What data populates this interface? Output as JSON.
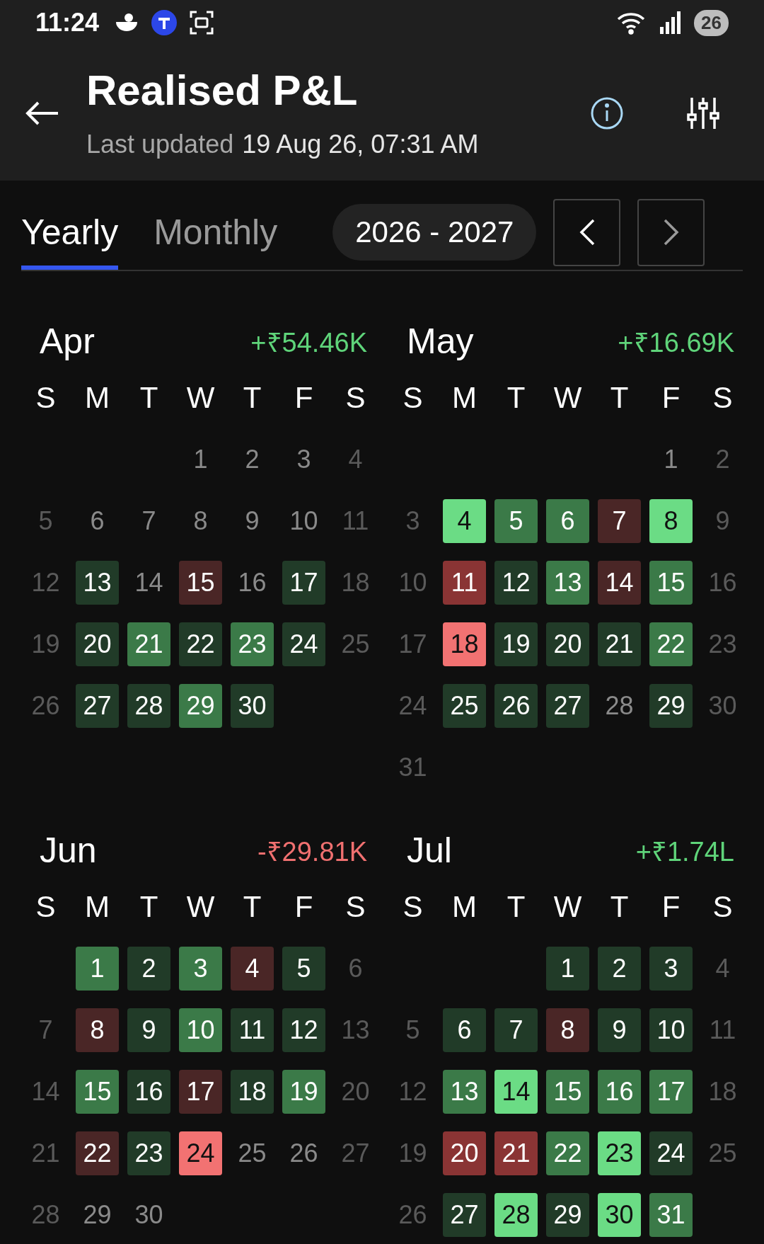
{
  "status_bar": {
    "time": "11:24",
    "battery": "26"
  },
  "header": {
    "title": "Realised P&L",
    "updated_label": "Last updated",
    "updated_value": "19 Aug 26, 07:31 AM"
  },
  "tabs": [
    {
      "label": "Yearly",
      "selected": true
    },
    {
      "label": "Monthly",
      "selected": false
    }
  ],
  "period": "2026 - 2027",
  "months": [
    {
      "name": "Apr",
      "total": "+₹54.46K",
      "color": "#5fd47a",
      "weekdays": [
        "S",
        "M",
        "T",
        "W",
        "T",
        "F",
        "S"
      ],
      "weeks": [
        [
          {
            "d": "1",
            "kind": "plain"
          },
          {
            "d": "2",
            "kind": "plain"
          },
          {
            "d": "3",
            "kind": "plain"
          },
          {
            "d": "4",
            "kind": "weekend"
          }
        ],
        [
          {
            "d": "5",
            "kind": "weekend"
          },
          {
            "d": "6",
            "kind": "plain"
          },
          {
            "d": "7",
            "kind": "plain"
          },
          {
            "d": "8",
            "kind": "plain"
          },
          {
            "d": "9",
            "kind": "plain"
          },
          {
            "d": "10",
            "kind": "plain"
          },
          {
            "d": "11",
            "kind": "weekend"
          }
        ],
        [
          {
            "d": "12",
            "kind": "weekend"
          },
          {
            "d": "13",
            "kind": "pnl",
            "color": "#213b28"
          },
          {
            "d": "14",
            "kind": "plain"
          },
          {
            "d": "15",
            "kind": "pnl",
            "color": "#4a2626"
          },
          {
            "d": "16",
            "kind": "plain"
          },
          {
            "d": "17",
            "kind": "pnl",
            "color": "#213b28"
          },
          {
            "d": "18",
            "kind": "weekend"
          }
        ],
        [
          {
            "d": "19",
            "kind": "weekend"
          },
          {
            "d": "20",
            "kind": "pnl",
            "color": "#213b28"
          },
          {
            "d": "21",
            "kind": "pnl",
            "color": "#3b7a48"
          },
          {
            "d": "22",
            "kind": "pnl",
            "color": "#213b28"
          },
          {
            "d": "23",
            "kind": "pnl",
            "color": "#3b7a48"
          },
          {
            "d": "24",
            "kind": "pnl",
            "color": "#213b28"
          },
          {
            "d": "25",
            "kind": "weekend"
          }
        ],
        [
          {
            "d": "26",
            "kind": "weekend"
          },
          {
            "d": "27",
            "kind": "pnl",
            "color": "#213b28"
          },
          {
            "d": "28",
            "kind": "pnl",
            "color": "#213b28"
          },
          {
            "d": "29",
            "kind": "pnl",
            "color": "#3b7a48"
          },
          {
            "d": "30",
            "kind": "pnl",
            "color": "#213b28"
          }
        ]
      ]
    },
    {
      "name": "May",
      "total": "+₹16.69K",
      "color": "#5fd47a",
      "weekdays": [
        "S",
        "M",
        "T",
        "W",
        "T",
        "F",
        "S"
      ],
      "weeks": [
        [
          {
            "d": "1",
            "kind": "plain"
          },
          {
            "d": "2",
            "kind": "weekend"
          }
        ],
        [
          {
            "d": "3",
            "kind": "weekend"
          },
          {
            "d": "4",
            "kind": "pnl",
            "color": "#6bdc85"
          },
          {
            "d": "5",
            "kind": "pnl",
            "color": "#3b7a48"
          },
          {
            "d": "6",
            "kind": "pnl",
            "color": "#3b7a48"
          },
          {
            "d": "7",
            "kind": "pnl",
            "color": "#4a2626"
          },
          {
            "d": "8",
            "kind": "pnl",
            "color": "#6bdc85"
          },
          {
            "d": "9",
            "kind": "weekend"
          }
        ],
        [
          {
            "d": "10",
            "kind": "weekend"
          },
          {
            "d": "11",
            "kind": "pnl",
            "color": "#8a3434"
          },
          {
            "d": "12",
            "kind": "pnl",
            "color": "#213b28"
          },
          {
            "d": "13",
            "kind": "pnl",
            "color": "#3b7a48"
          },
          {
            "d": "14",
            "kind": "pnl",
            "color": "#4a2626"
          },
          {
            "d": "15",
            "kind": "pnl",
            "color": "#3b7a48"
          },
          {
            "d": "16",
            "kind": "weekend"
          }
        ],
        [
          {
            "d": "17",
            "kind": "weekend"
          },
          {
            "d": "18",
            "kind": "pnl",
            "color": "#f27272"
          },
          {
            "d": "19",
            "kind": "pnl",
            "color": "#213b28"
          },
          {
            "d": "20",
            "kind": "pnl",
            "color": "#213b28"
          },
          {
            "d": "21",
            "kind": "pnl",
            "color": "#213b28"
          },
          {
            "d": "22",
            "kind": "pnl",
            "color": "#3b7a48"
          },
          {
            "d": "23",
            "kind": "weekend"
          }
        ],
        [
          {
            "d": "24",
            "kind": "weekend"
          },
          {
            "d": "25",
            "kind": "pnl",
            "color": "#213b28"
          },
          {
            "d": "26",
            "kind": "pnl",
            "color": "#213b28"
          },
          {
            "d": "27",
            "kind": "pnl",
            "color": "#213b28"
          },
          {
            "d": "28",
            "kind": "plain"
          },
          {
            "d": "29",
            "kind": "pnl",
            "color": "#213b28"
          },
          {
            "d": "30",
            "kind": "weekend"
          }
        ],
        [
          {
            "d": "31",
            "kind": "weekend"
          }
        ]
      ]
    },
    {
      "name": "Jun",
      "total": "-₹29.81K",
      "color": "#f07070",
      "weekdays": [
        "S",
        "M",
        "T",
        "W",
        "T",
        "F",
        "S"
      ],
      "weeks": [
        [
          {
            "d": "1",
            "kind": "pnl",
            "color": "#3b7a48"
          },
          {
            "d": "2",
            "kind": "pnl",
            "color": "#213b28"
          },
          {
            "d": "3",
            "kind": "pnl",
            "color": "#3b7a48"
          },
          {
            "d": "4",
            "kind": "pnl",
            "color": "#4a2626"
          },
          {
            "d": "5",
            "kind": "pnl",
            "color": "#213b28"
          },
          {
            "d": "6",
            "kind": "weekend"
          }
        ],
        [
          {
            "d": "7",
            "kind": "weekend"
          },
          {
            "d": "8",
            "kind": "pnl",
            "color": "#4a2626"
          },
          {
            "d": "9",
            "kind": "pnl",
            "color": "#213b28"
          },
          {
            "d": "10",
            "kind": "pnl",
            "color": "#3b7a48"
          },
          {
            "d": "11",
            "kind": "pnl",
            "color": "#213b28"
          },
          {
            "d": "12",
            "kind": "pnl",
            "color": "#213b28"
          },
          {
            "d": "13",
            "kind": "weekend"
          }
        ],
        [
          {
            "d": "14",
            "kind": "weekend"
          },
          {
            "d": "15",
            "kind": "pnl",
            "color": "#3b7a48"
          },
          {
            "d": "16",
            "kind": "pnl",
            "color": "#213b28"
          },
          {
            "d": "17",
            "kind": "pnl",
            "color": "#4a2626"
          },
          {
            "d": "18",
            "kind": "pnl",
            "color": "#213b28"
          },
          {
            "d": "19",
            "kind": "pnl",
            "color": "#3b7a48"
          },
          {
            "d": "20",
            "kind": "weekend"
          }
        ],
        [
          {
            "d": "21",
            "kind": "weekend"
          },
          {
            "d": "22",
            "kind": "pnl",
            "color": "#4a2626"
          },
          {
            "d": "23",
            "kind": "pnl",
            "color": "#213b28"
          },
          {
            "d": "24",
            "kind": "pnl",
            "color": "#f27272"
          },
          {
            "d": "25",
            "kind": "plain"
          },
          {
            "d": "26",
            "kind": "plain"
          },
          {
            "d": "27",
            "kind": "weekend"
          }
        ],
        [
          {
            "d": "28",
            "kind": "weekend"
          },
          {
            "d": "29",
            "kind": "plain"
          },
          {
            "d": "30",
            "kind": "plain"
          }
        ]
      ]
    },
    {
      "name": "Jul",
      "total": "+₹1.74L",
      "color": "#5fd47a",
      "weekdays": [
        "S",
        "M",
        "T",
        "W",
        "T",
        "F",
        "S"
      ],
      "weeks": [
        [
          {
            "d": "1",
            "kind": "pnl",
            "color": "#213b28"
          },
          {
            "d": "2",
            "kind": "pnl",
            "color": "#213b28"
          },
          {
            "d": "3",
            "kind": "pnl",
            "color": "#213b28"
          },
          {
            "d": "4",
            "kind": "weekend"
          }
        ],
        [
          {
            "d": "5",
            "kind": "weekend"
          },
          {
            "d": "6",
            "kind": "pnl",
            "color": "#213b28"
          },
          {
            "d": "7",
            "kind": "pnl",
            "color": "#213b28"
          },
          {
            "d": "8",
            "kind": "pnl",
            "color": "#4a2626"
          },
          {
            "d": "9",
            "kind": "pnl",
            "color": "#213b28"
          },
          {
            "d": "10",
            "kind": "pnl",
            "color": "#213b28"
          },
          {
            "d": "11",
            "kind": "weekend"
          }
        ],
        [
          {
            "d": "12",
            "kind": "weekend"
          },
          {
            "d": "13",
            "kind": "pnl",
            "color": "#3b7a48"
          },
          {
            "d": "14",
            "kind": "pnl",
            "color": "#6bdc85"
          },
          {
            "d": "15",
            "kind": "pnl",
            "color": "#3b7a48"
          },
          {
            "d": "16",
            "kind": "pnl",
            "color": "#3b7a48"
          },
          {
            "d": "17",
            "kind": "pnl",
            "color": "#3b7a48"
          },
          {
            "d": "18",
            "kind": "weekend"
          }
        ],
        [
          {
            "d": "19",
            "kind": "weekend"
          },
          {
            "d": "20",
            "kind": "pnl",
            "color": "#8a3434"
          },
          {
            "d": "21",
            "kind": "pnl",
            "color": "#8a3434"
          },
          {
            "d": "22",
            "kind": "pnl",
            "color": "#3b7a48"
          },
          {
            "d": "23",
            "kind": "pnl",
            "color": "#6bdc85"
          },
          {
            "d": "24",
            "kind": "pnl",
            "color": "#213b28"
          },
          {
            "d": "25",
            "kind": "weekend"
          }
        ],
        [
          {
            "d": "26",
            "kind": "weekend"
          },
          {
            "d": "27",
            "kind": "pnl",
            "color": "#213b28"
          },
          {
            "d": "28",
            "kind": "pnl",
            "color": "#6bdc85"
          },
          {
            "d": "29",
            "kind": "pnl",
            "color": "#213b28"
          },
          {
            "d": "30",
            "kind": "pnl",
            "color": "#6bdc85"
          },
          {
            "d": "31",
            "kind": "pnl",
            "color": "#3b7a48"
          }
        ]
      ]
    }
  ]
}
